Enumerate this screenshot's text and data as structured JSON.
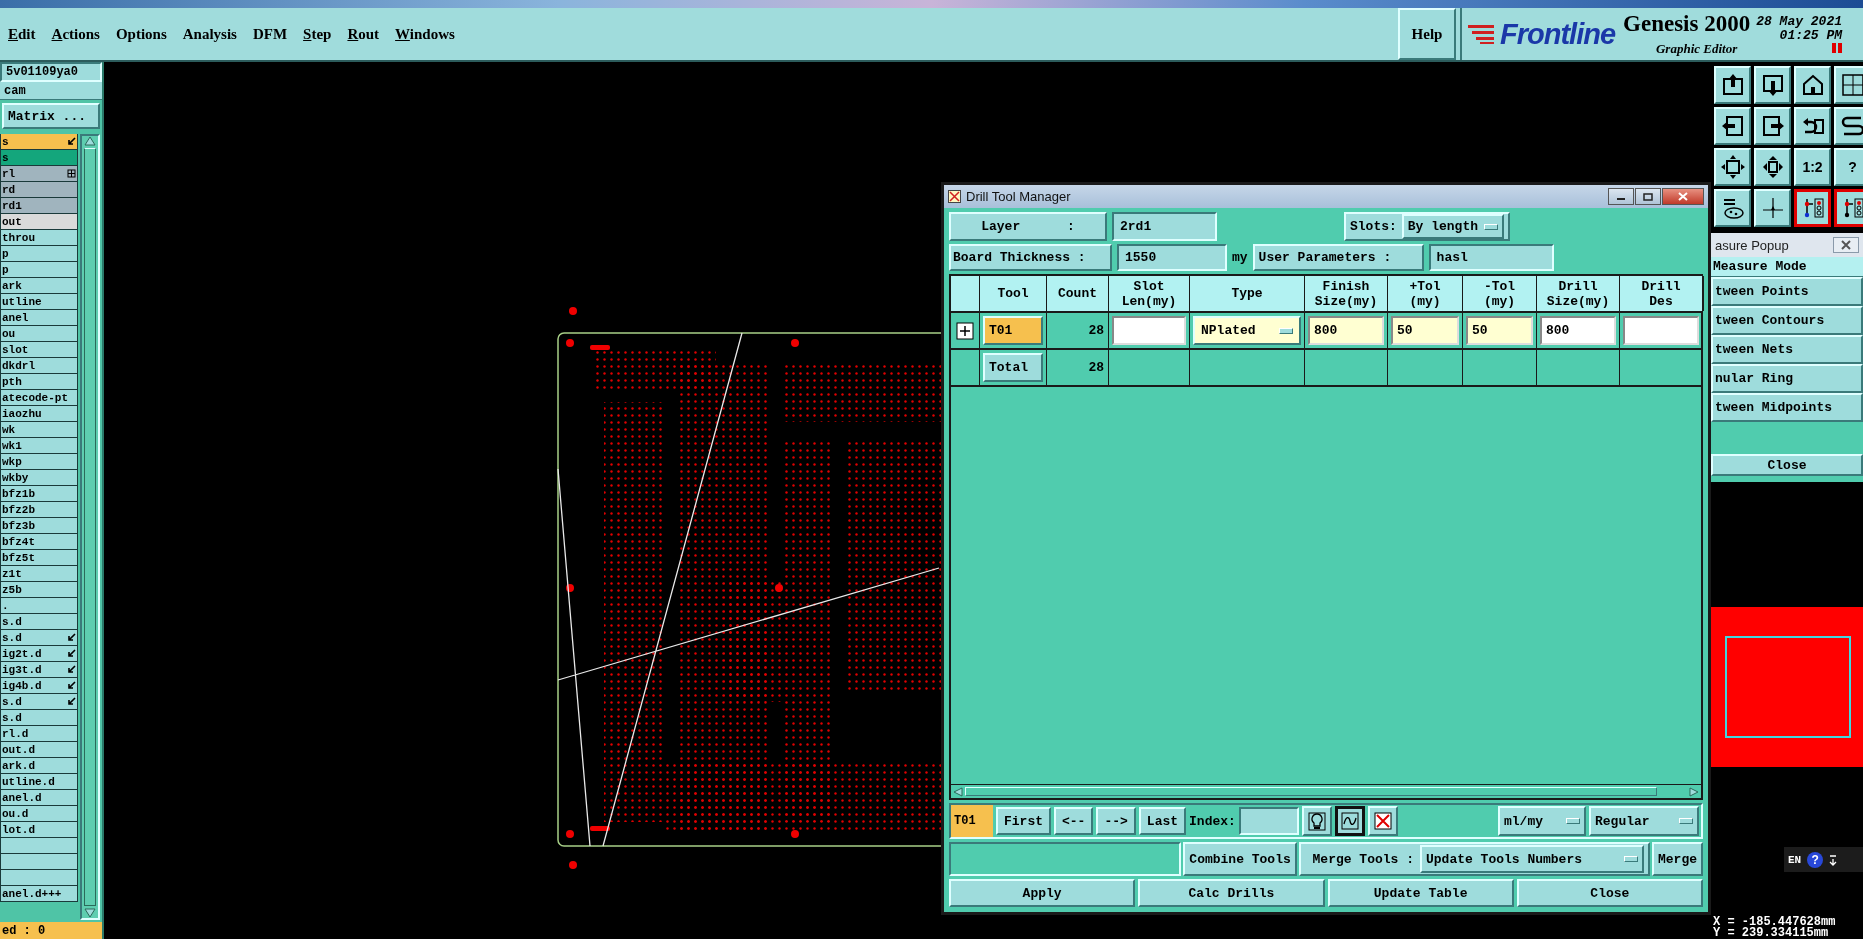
{
  "menubar": {
    "items": [
      {
        "label": "Edit",
        "mnemonic": true
      },
      {
        "label": "Actions",
        "mnemonic": true
      },
      {
        "label": "Options",
        "mnemonic": false
      },
      {
        "label": "Analysis",
        "mnemonic": false
      },
      {
        "label": "DFM",
        "mnemonic": false
      },
      {
        "label": "Step",
        "mnemonic": true
      },
      {
        "label": "Rout",
        "mnemonic": true
      },
      {
        "label": "Windows",
        "mnemonic": true
      }
    ],
    "help": "Help",
    "logo": "Frontline",
    "product": "Genesis 2000",
    "subtitle": "Graphic Editor",
    "date": "28 May 2021",
    "time": "01:25 PM"
  },
  "sidebar": {
    "job": "5v01109ya0",
    "user": "cam",
    "matrix_button": "Matrix ...",
    "layers": [
      {
        "label": "s",
        "color": "#f6c04e",
        "flagged": true,
        "expandable": false
      },
      {
        "label": "s",
        "color": "#14a67c",
        "flagged": false,
        "expandable": false
      },
      {
        "label": "rl",
        "color": "#a0b4be",
        "flagged": false,
        "expandable": true
      },
      {
        "label": "rd",
        "color": "#a0b4be",
        "flagged": false,
        "expandable": false
      },
      {
        "label": "rd1",
        "color": "#a0b4be",
        "flagged": false,
        "expandable": false
      },
      {
        "label": "out",
        "color": "#dadada",
        "flagged": false,
        "expandable": false
      },
      {
        "label": "throu",
        "color": "#9edcdc",
        "flagged": false,
        "expandable": false
      },
      {
        "label": "p",
        "color": "#9edcdc",
        "flagged": false,
        "expandable": false
      },
      {
        "label": "p",
        "color": "#9edcdc",
        "flagged": false,
        "expandable": false
      },
      {
        "label": "ark",
        "color": "#9edcdc",
        "flagged": false,
        "expandable": false
      },
      {
        "label": "utline",
        "color": "#9edcdc",
        "flagged": false,
        "expandable": false
      },
      {
        "label": "anel",
        "color": "#9edcdc",
        "flagged": false,
        "expandable": false
      },
      {
        "label": "ou",
        "color": "#9edcdc",
        "flagged": false,
        "expandable": false
      },
      {
        "label": "slot",
        "color": "#9edcdc",
        "flagged": false,
        "expandable": false
      },
      {
        "label": "dkdrl",
        "color": "#9edcdc",
        "flagged": false,
        "expandable": false
      },
      {
        "label": "pth",
        "color": "#9edcdc",
        "flagged": false,
        "expandable": false
      },
      {
        "label": "atecode-pt",
        "color": "#9edcdc",
        "flagged": false,
        "expandable": false
      },
      {
        "label": "iaozhu",
        "color": "#9edcdc",
        "flagged": false,
        "expandable": false
      },
      {
        "label": "wk",
        "color": "#9edcdc",
        "flagged": false,
        "expandable": false
      },
      {
        "label": "wk1",
        "color": "#9edcdc",
        "flagged": false,
        "expandable": false
      },
      {
        "label": "wkp",
        "color": "#9edcdc",
        "flagged": false,
        "expandable": false
      },
      {
        "label": "wkby",
        "color": "#9edcdc",
        "flagged": false,
        "expandable": false
      },
      {
        "label": "bfz1b",
        "color": "#9edcdc",
        "flagged": false,
        "expandable": false
      },
      {
        "label": "bfz2b",
        "color": "#9edcdc",
        "flagged": false,
        "expandable": false
      },
      {
        "label": "bfz3b",
        "color": "#9edcdc",
        "flagged": false,
        "expandable": false
      },
      {
        "label": "bfz4t",
        "color": "#9edcdc",
        "flagged": false,
        "expandable": false
      },
      {
        "label": "bfz5t",
        "color": "#9edcdc",
        "flagged": false,
        "expandable": false
      },
      {
        "label": "z1t",
        "color": "#9edcdc",
        "flagged": false,
        "expandable": false
      },
      {
        "label": "z5b",
        "color": "#9edcdc",
        "flagged": false,
        "expandable": false
      },
      {
        "label": ".",
        "color": "#9edcdc",
        "flagged": false,
        "expandable": false
      },
      {
        "label": "s.d",
        "color": "#9edcdc",
        "flagged": false,
        "expandable": false
      },
      {
        "label": "s.d",
        "color": "#9edcdc",
        "flagged": true,
        "expandable": false
      },
      {
        "label": "ig2t.d",
        "color": "#9edcdc",
        "flagged": true,
        "expandable": false
      },
      {
        "label": "ig3t.d",
        "color": "#9edcdc",
        "flagged": true,
        "expandable": false
      },
      {
        "label": "ig4b.d",
        "color": "#9edcdc",
        "flagged": true,
        "expandable": false
      },
      {
        "label": "s.d",
        "color": "#9edcdc",
        "flagged": true,
        "expandable": false
      },
      {
        "label": "s.d",
        "color": "#9edcdc",
        "flagged": false,
        "expandable": false
      },
      {
        "label": "rl.d",
        "color": "#9edcdc",
        "flagged": false,
        "expandable": false
      },
      {
        "label": "out.d",
        "color": "#9edcdc",
        "flagged": false,
        "expandable": false
      },
      {
        "label": "ark.d",
        "color": "#9edcdc",
        "flagged": false,
        "expandable": false
      },
      {
        "label": "utline.d",
        "color": "#9edcdc",
        "flagged": false,
        "expandable": false
      },
      {
        "label": "anel.d",
        "color": "#9edcdc",
        "flagged": false,
        "expandable": false
      },
      {
        "label": "ou.d",
        "color": "#9edcdc",
        "flagged": false,
        "expandable": false
      },
      {
        "label": "lot.d",
        "color": "#9edcdc",
        "flagged": false,
        "expandable": false
      },
      {
        "color": "#9edcdc",
        "flagged": false,
        "expandable": false
      },
      {
        "color": "#9edcdc",
        "flagged": false,
        "expandable": false
      },
      {
        "color": "#9edcdc",
        "flagged": false,
        "expandable": false
      },
      {
        "label": "anel.d+++",
        "color": "#9edcdc",
        "flagged": false,
        "expandable": false
      }
    ],
    "status": "ed : 0"
  },
  "dialog": {
    "title": "Drill Tool Manager",
    "layer_label": "Layer      :",
    "layer_value": "2rd1",
    "slots_label": "Slots:",
    "slots_value": "By length",
    "thickness_label": "Board Thickness :",
    "thickness_value": "1550",
    "thickness_unit": "my",
    "user_params_button": "User Parameters :",
    "user_params_value": "hasl",
    "table": {
      "columns": [
        "Tool",
        "Count",
        "Slot\nLen(my)",
        "Type",
        "Finish\nSize(my)",
        "+Tol\n(my)",
        "-Tol\n(my)",
        "Drill\nSize(my)",
        "Drill\nDes"
      ],
      "rows": [
        {
          "expandable": true,
          "cells": [
            {
              "kind": "tool",
              "value": "T01",
              "selected": true
            },
            {
              "kind": "count",
              "value": "28"
            },
            {
              "kind": "input",
              "highlighted": false
            },
            {
              "kind": "dropdown",
              "value": "NPlated",
              "highlighted": true
            },
            {
              "kind": "input",
              "value": "800",
              "highlighted": true
            },
            {
              "kind": "input",
              "value": "50",
              "highlighted": true
            },
            {
              "kind": "input",
              "value": "50",
              "highlighted": true
            },
            {
              "kind": "input",
              "value": "800",
              "highlighted": false
            },
            {
              "kind": "input",
              "highlighted": false
            }
          ]
        },
        {
          "expandable": false,
          "cells": [
            {
              "kind": "tool",
              "value": "Total",
              "selected": false
            },
            {
              "kind": "count",
              "value": "28"
            },
            {
              "kind": "blank"
            },
            {
              "kind": "blank"
            },
            {
              "kind": "blank"
            },
            {
              "kind": "blank"
            },
            {
              "kind": "blank"
            },
            {
              "kind": "blank"
            },
            {
              "kind": "blank"
            }
          ]
        }
      ]
    },
    "current_tool": "T01",
    "nav_buttons": [
      "First",
      "<--",
      "-->",
      "Last"
    ],
    "index_label": "Index:",
    "tool_buttons": [
      {
        "selected": false
      },
      {
        "selected": true
      },
      {
        "selected": false
      }
    ],
    "units": "ml/my",
    "mode": "Regular",
    "combine_button": "Combine Tools",
    "merge_label": "Merge Tools :",
    "merge_option": "Update Tools Numbers",
    "merge_button": "Merge",
    "actions": [
      "Apply",
      "Calc Drills",
      "Update Table",
      "Close"
    ]
  },
  "toolbar": {
    "buttons": [
      {
        "kind": "icon",
        "active": false
      },
      {
        "kind": "icon",
        "active": false
      },
      {
        "kind": "icon",
        "active": false
      },
      {
        "kind": "icon",
        "active": false
      },
      {
        "kind": "icon",
        "active": false
      },
      {
        "kind": "icon",
        "active": false
      },
      {
        "kind": "icon",
        "active": false
      },
      {
        "kind": "icon",
        "active": false
      },
      {
        "kind": "icon",
        "active": false
      },
      {
        "kind": "icon",
        "active": false
      },
      {
        "kind": "text",
        "label": "1:2",
        "active": false
      },
      {
        "kind": "text",
        "label": "?",
        "active": false
      },
      {
        "kind": "icon",
        "active": false
      },
      {
        "kind": "icon",
        "active": false
      },
      {
        "kind": "icon",
        "active": true
      },
      {
        "kind": "icon",
        "active": true
      }
    ]
  },
  "measure_popup": {
    "title": "asure Popup",
    "heading": "Measure Mode",
    "options": [
      "tween Points",
      "tween Contours",
      "tween Nets",
      "nular Ring",
      "tween Midpoints"
    ],
    "close": "Close"
  },
  "language_bar": {
    "label": "EN",
    "help": "?"
  },
  "coordinates": {
    "x": "X = -185.447628mm",
    "y": "Y = 239.334115mm"
  }
}
